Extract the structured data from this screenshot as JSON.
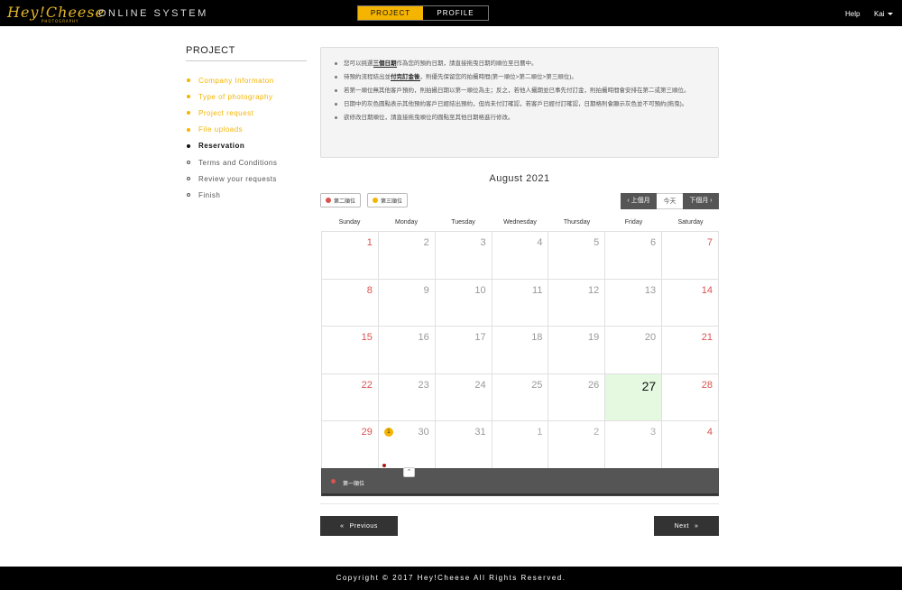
{
  "header": {
    "logo_text": "Hey!Cheese",
    "logo_sub": "PHOTOGRAPHY",
    "system_title": "ONLINE SYSTEM",
    "tabs": [
      {
        "label": "PROJECT",
        "active": true
      },
      {
        "label": "PROFILE",
        "active": false
      }
    ],
    "help_label": "Help",
    "user_label": "Kai"
  },
  "sidebar": {
    "title": "PROJECT",
    "steps": [
      {
        "label": "Company Informaton",
        "state": "done"
      },
      {
        "label": "Type of photography",
        "state": "done"
      },
      {
        "label": "Project request",
        "state": "done"
      },
      {
        "label": "File uploads",
        "state": "done"
      },
      {
        "label": "Reservation",
        "state": "current"
      },
      {
        "label": "Terms and Conditions",
        "state": "todo"
      },
      {
        "label": "Review your requests",
        "state": "todo"
      },
      {
        "label": "Finish",
        "state": "todo"
      }
    ]
  },
  "info": {
    "items": [
      {
        "pre": "您可以挑選",
        "bold": "三個日期",
        "post": "作為您的預約日期，請直接拖曳日期的順位至日曆中。"
      },
      {
        "pre": "待預約流程結出並",
        "bold": "付完訂金後",
        "post": "，則優先保留您的拍攝時間(第一順位>第二順位>第三順位)。"
      },
      {
        "pre": "若第一順位無其他客戶預約，則拍攝日期以第一順位為主；反之，若他人攝期並已事先付訂金，則拍攝時間會安排在第二或第三順位。",
        "bold": "",
        "post": ""
      },
      {
        "pre": "日期中的灰色圓點表示其他預約客戶已經結出預約，但尚未付訂確認，若客戶已經付訂確認，日期格則會顯示灰色並不可預約(拖曳)。",
        "bold": "",
        "post": ""
      },
      {
        "pre": "欲修改日期順位，請直接拖曳順位的圓點至其他日期格進行修改。",
        "bold": "",
        "post": ""
      }
    ]
  },
  "calendar": {
    "month_title": "August 2021",
    "legend": [
      {
        "label": "第二順位",
        "color": "#d9534f"
      },
      {
        "label": "第三順位",
        "color": "#f5b400"
      }
    ],
    "nav": {
      "prev": "‹ 上個月",
      "today": "今天",
      "next": "下個月 ›"
    },
    "weekdays": [
      "Sunday",
      "Monday",
      "Tuesday",
      "Wednesday",
      "Thursday",
      "Friday",
      "Saturday"
    ],
    "weeks": [
      [
        {
          "n": "1"
        },
        {
          "n": "2"
        },
        {
          "n": "3"
        },
        {
          "n": "4"
        },
        {
          "n": "5"
        },
        {
          "n": "6"
        },
        {
          "n": "7"
        }
      ],
      [
        {
          "n": "8"
        },
        {
          "n": "9"
        },
        {
          "n": "10"
        },
        {
          "n": "11"
        },
        {
          "n": "12"
        },
        {
          "n": "13"
        },
        {
          "n": "14"
        }
      ],
      [
        {
          "n": "15"
        },
        {
          "n": "16"
        },
        {
          "n": "17"
        },
        {
          "n": "18"
        },
        {
          "n": "19"
        },
        {
          "n": "20"
        },
        {
          "n": "21"
        }
      ],
      [
        {
          "n": "22"
        },
        {
          "n": "23"
        },
        {
          "n": "24"
        },
        {
          "n": "25"
        },
        {
          "n": "26"
        },
        {
          "n": "27",
          "today": true
        },
        {
          "n": "28"
        }
      ],
      [
        {
          "n": "29"
        },
        {
          "n": "30",
          "badge": "1"
        },
        {
          "n": "31"
        },
        {
          "n": "1",
          "other": true
        },
        {
          "n": "2",
          "other": true
        },
        {
          "n": "3",
          "other": true
        },
        {
          "n": "4",
          "other": true
        }
      ]
    ],
    "bar_label": "第一順位",
    "bar_dot_color": "#d9534f"
  },
  "buttons": {
    "previous": "Previous",
    "next": "Next"
  },
  "footer": {
    "copyright": "Copyright © 2017 Hey!Cheese All Rights Reserved."
  }
}
